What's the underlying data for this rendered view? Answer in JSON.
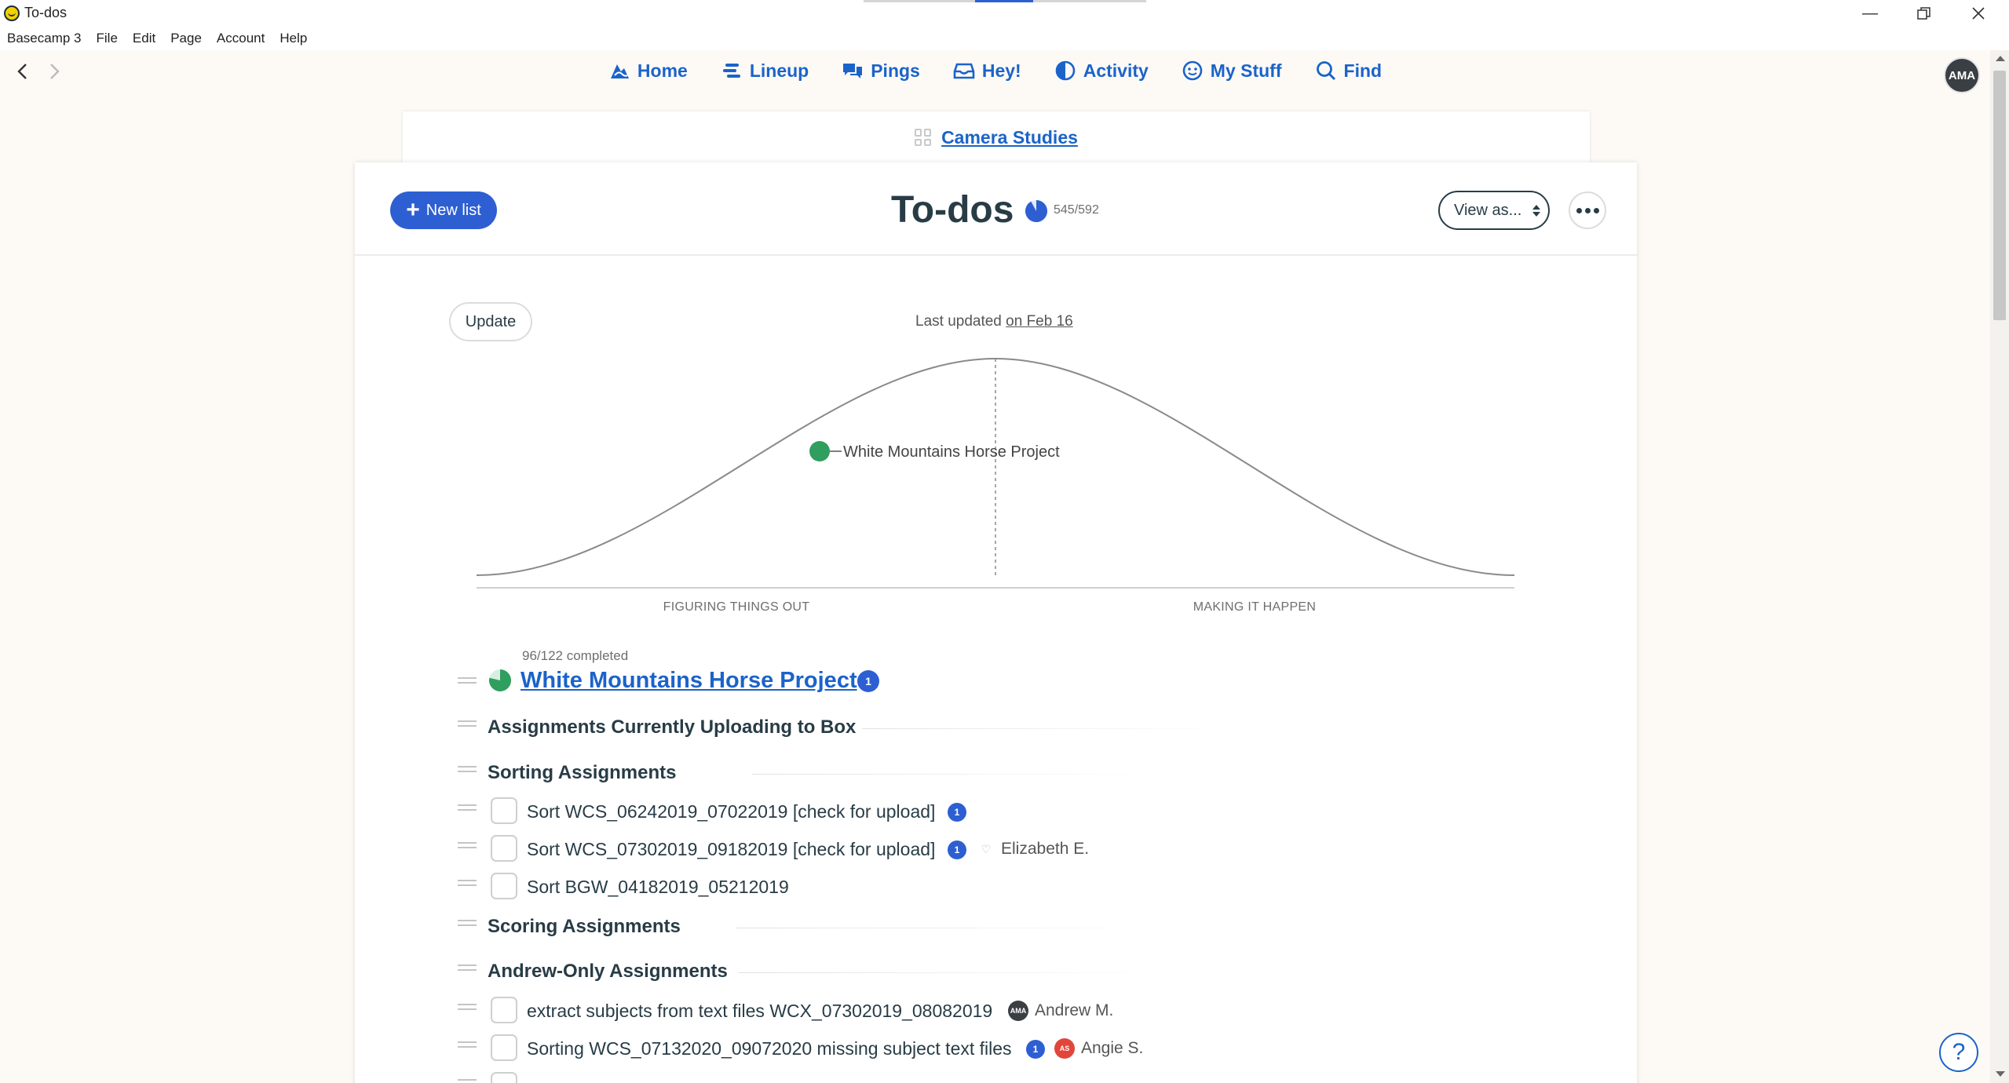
{
  "window": {
    "title": "To-dos"
  },
  "menu": {
    "items": [
      "Basecamp 3",
      "File",
      "Edit",
      "Page",
      "Account",
      "Help"
    ]
  },
  "nav": {
    "items": [
      {
        "label": "Home",
        "icon": "home-icon"
      },
      {
        "label": "Lineup",
        "icon": "lineup-icon"
      },
      {
        "label": "Pings",
        "icon": "pings-icon"
      },
      {
        "label": "Hey!",
        "icon": "hey-icon"
      },
      {
        "label": "Activity",
        "icon": "activity-icon"
      },
      {
        "label": "My Stuff",
        "icon": "my-stuff-icon"
      },
      {
        "label": "Find",
        "icon": "find-icon"
      }
    ],
    "avatar_initials": "AMA"
  },
  "project": {
    "name": "Camera Studies"
  },
  "todos": {
    "title": "To-dos",
    "progress": "545/592",
    "progress_fraction": 0.9206,
    "new_list_label": "New list",
    "view_as_label": "View as..."
  },
  "hill": {
    "update_label": "Update",
    "last_updated_prefix": "Last updated",
    "last_updated_date": "on Feb 16",
    "left_label": "FIGURING THINGS OUT",
    "right_label": "MAKING IT HAPPEN",
    "dot_label": "White Mountains Horse Project",
    "dot_color": "#2f9e5f"
  },
  "list": {
    "completed": "96/122 completed",
    "completed_fraction": 0.787,
    "title": "White Mountains Horse Project",
    "comment_count": "1",
    "groups": [
      {
        "title": "Assignments Currently Uploading to Box",
        "items": []
      },
      {
        "title": "Sorting Assignments",
        "items": [
          {
            "text": "Sort WCS_06242019_07022019 [check for upload]",
            "comments": "1",
            "assignee": ""
          },
          {
            "text": "Sort WCS_07302019_09182019 [check for upload]",
            "comments": "1",
            "assignee": "Elizabeth E."
          },
          {
            "text": "Sort BGW_04182019_05212019",
            "comments": "",
            "assignee": ""
          }
        ]
      },
      {
        "title": "Scoring Assignments",
        "items": []
      },
      {
        "title": "Andrew-Only Assignments",
        "items": [
          {
            "text": "extract subjects from text files WCX_07302019_08082019",
            "comments": "",
            "assignee": "Andrew M.",
            "assignee_initials": "AMA"
          },
          {
            "text": "Sorting WCS_07132020_09072020 missing subject text files",
            "comments": "1",
            "assignee": "Angie S.",
            "assignee_initials": "AS"
          }
        ]
      }
    ]
  },
  "colors": {
    "accent": "#1b63c9",
    "button": "#2d5fd3",
    "hill_dot": "#2f9e5f",
    "text": "#283c46"
  }
}
